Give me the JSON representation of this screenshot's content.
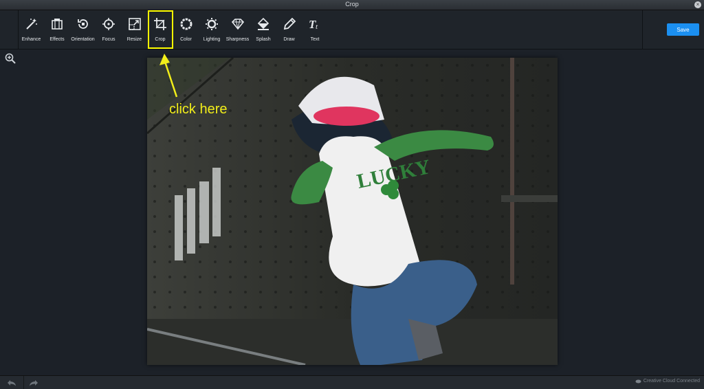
{
  "window": {
    "title": "Crop"
  },
  "toolbar": {
    "tools": [
      {
        "label": "Enhance",
        "icon": "magic-wand-icon"
      },
      {
        "label": "Effects",
        "icon": "film-strip-icon"
      },
      {
        "label": "Orientation",
        "icon": "rotate-icon"
      },
      {
        "label": "Focus",
        "icon": "target-icon"
      },
      {
        "label": "Resize",
        "icon": "resize-icon"
      },
      {
        "label": "Crop",
        "icon": "crop-icon",
        "active": true
      },
      {
        "label": "Color",
        "icon": "color-wheel-icon"
      },
      {
        "label": "Lighting",
        "icon": "sun-icon"
      },
      {
        "label": "Sharpness",
        "icon": "diamond-icon"
      },
      {
        "label": "Splash",
        "icon": "paint-bucket-icon"
      },
      {
        "label": "Draw",
        "icon": "pencil-icon"
      },
      {
        "label": "Text",
        "icon": "text-icon"
      }
    ],
    "save_label": "Save"
  },
  "annotation": {
    "text": "click here",
    "color": "#f2ee1a"
  },
  "photo": {
    "shirt_text": "LUCKY"
  },
  "status": {
    "connection": "Creative Cloud Connected"
  },
  "colors": {
    "accent": "#1b8ff0",
    "highlight": "#ffff00"
  }
}
